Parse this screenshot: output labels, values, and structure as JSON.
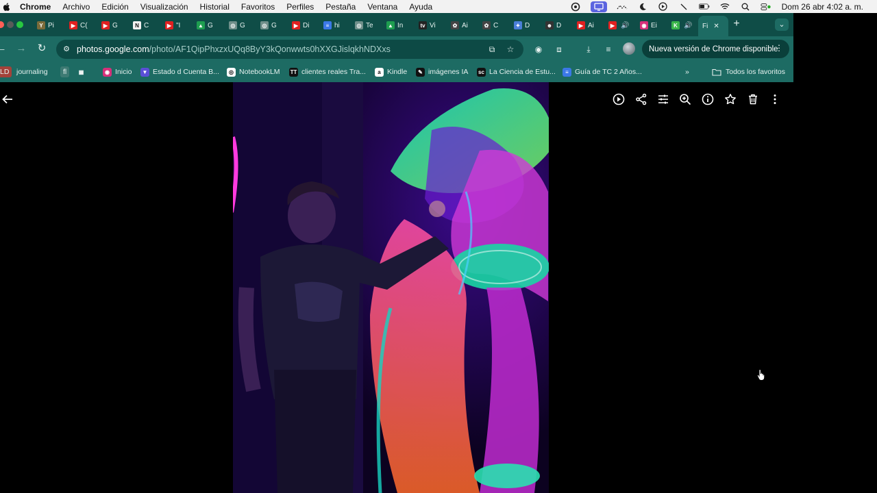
{
  "menubar": {
    "app": "Chrome",
    "items": [
      "Archivo",
      "Edición",
      "Visualización",
      "Historial",
      "Favoritos",
      "Perfiles",
      "Pestaña",
      "Ventana",
      "Ayuda"
    ],
    "clock": "Dom 26 abr  4:02 a. m."
  },
  "tabs": [
    {
      "label": "Pi",
      "color": "#7a6b3a",
      "glyph": "Y"
    },
    {
      "label": "C(",
      "color": "#e02020",
      "glyph": "▶"
    },
    {
      "label": "G",
      "color": "#e02020",
      "glyph": "▶"
    },
    {
      "label": "C",
      "color": "#f2f2f2",
      "glyph": "N"
    },
    {
      "label": "\"I",
      "color": "#e02020",
      "glyph": "▶"
    },
    {
      "label": "G",
      "color": "#1e9e50",
      "glyph": "▲"
    },
    {
      "label": "G",
      "color": "#6f8f8a",
      "glyph": "◎"
    },
    {
      "label": "G",
      "color": "#6f8f8a",
      "glyph": "◎"
    },
    {
      "label": "Di",
      "color": "#e02020",
      "glyph": "▶"
    },
    {
      "label": "hi",
      "color": "#3b78e7",
      "glyph": "≡"
    },
    {
      "label": "Te",
      "color": "#6f8f8a",
      "glyph": "◎"
    },
    {
      "label": "In",
      "color": "#1e9e50",
      "glyph": "▲"
    },
    {
      "label": "Vi",
      "color": "#222222",
      "glyph": "tv"
    },
    {
      "label": "Ai",
      "color": "#444444",
      "glyph": "✿"
    },
    {
      "label": "C",
      "color": "#444444",
      "glyph": "✿"
    },
    {
      "label": "D",
      "color": "#4a7fd8",
      "glyph": "✦"
    },
    {
      "label": "D",
      "color": "#333333",
      "glyph": "☻"
    },
    {
      "label": "Ai",
      "color": "#e02020",
      "glyph": "▶"
    },
    {
      "label": "",
      "color": "#e02020",
      "glyph": "▶"
    },
    {
      "label": "Ei",
      "color": "#d6307a",
      "glyph": "◉"
    },
    {
      "label": "",
      "color": "#39b54a",
      "glyph": "K"
    },
    {
      "label": "Fi",
      "color": "#1d6b63",
      "glyph": ""
    }
  ],
  "omnibox": {
    "domain": "photos.google.com",
    "path": "/photo/AF1QipPhxzxUQq8ByY3kQonwwts0hXXGJislqkhNDXxs"
  },
  "update_banner": "Nueva versión de Chrome disponible",
  "bookmarks": [
    {
      "label": "LD",
      "color": "#a33",
      "glyph": ""
    },
    {
      "label": "journaling",
      "color": "",
      "glyph": ""
    },
    {
      "label": "fl",
      "color": "",
      "glyph": ""
    },
    {
      "label": "",
      "color": "#1d6b63",
      "glyph": "▦"
    },
    {
      "label": "Inicio",
      "color": "#d6307a",
      "glyph": "◉"
    },
    {
      "label": "Estado d Cuenta B...",
      "color": "#5a4fd6",
      "glyph": "▼"
    },
    {
      "label": "NotebookLM",
      "color": "#ffffff",
      "glyph": "◎"
    },
    {
      "label": "clientes reales Tra...",
      "color": "#111111",
      "glyph": "TT"
    },
    {
      "label": "Kindle",
      "color": "#ffffff",
      "glyph": "a"
    },
    {
      "label": "imágenes IA",
      "color": "#111111",
      "glyph": "✎"
    },
    {
      "label": "La Ciencia de Estu...",
      "color": "#111111",
      "glyph": "sc"
    },
    {
      "label": "Guía de TC 2 Años...",
      "color": "#3b78e7",
      "glyph": "≡"
    }
  ],
  "bookmarks_more": "»",
  "all_favorites": "Todos los favoritos",
  "viewer_tools": [
    "slideshow-icon",
    "share-icon",
    "edit-icon",
    "zoom-icon",
    "info-icon",
    "favorite-icon",
    "delete-icon",
    "more-icon"
  ]
}
